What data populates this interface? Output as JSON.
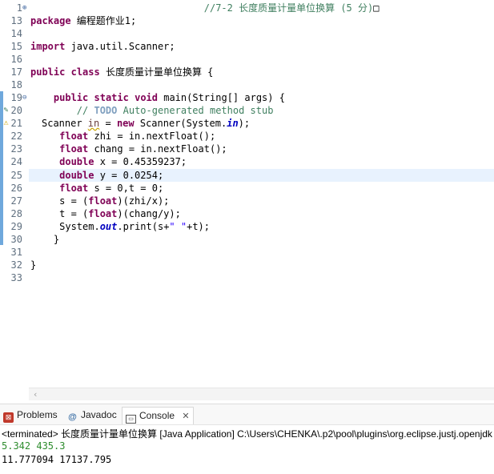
{
  "editor": {
    "line_numbers": [
      "1",
      "13",
      "14",
      "15",
      "16",
      "17",
      "18",
      "19",
      "20",
      "21",
      "22",
      "23",
      "24",
      "25",
      "26",
      "27",
      "28",
      "29",
      "30",
      "31",
      "32",
      "33"
    ],
    "fold_marks": {
      "line_1": "⊕",
      "line_19": "⊖"
    },
    "lines": {
      "l1_comment": "//7-2 长度质量计量单位换算 (5 分)",
      "l1_box": "□",
      "l13_kw": "package",
      "l13_rest": " 编程题作业1;",
      "l15_kw": "import",
      "l15_rest": " java.util.Scanner;",
      "l17_kw1": "public",
      "l17_kw2": "class",
      "l17_rest": " 长度质量计量单位换算 {",
      "l19_kw1": "public",
      "l19_kw2": "static",
      "l19_kw3": "void",
      "l19_rest": " main(String[] args) {",
      "l20_a": "// ",
      "l20_todo": "TODO",
      "l20_b": " Auto-generated method stub",
      "l21_a": "Scanner ",
      "l21_in": "in",
      "l21_b": " = ",
      "l21_new": "new",
      "l21_c": " Scanner(System.",
      "l21_in2": "in",
      "l21_d": ");",
      "l22_kw": "float",
      "l22_rest": " zhi = in.nextFloat();",
      "l23_kw": "float",
      "l23_rest": " chang = in.nextFloat();",
      "l24_kw": "double",
      "l24_rest": " x = 0.45359237;",
      "l25_kw": "double",
      "l25_rest": " y = 0.0254;",
      "l26_kw": "float",
      "l26_rest": " s = 0,t = 0;",
      "l27_a": "s = (",
      "l27_kw": "float",
      "l27_b": ")(zhi/x);",
      "l28_a": "t = (",
      "l28_kw": "float",
      "l28_b": ")(chang/y);",
      "l29_a": "System.",
      "l29_out": "out",
      "l29_b": ".print(s+",
      "l29_str": "\" \"",
      "l29_c": "+t);",
      "l30": "}",
      "l32": "}"
    },
    "scroll_arrow": "‹"
  },
  "console": {
    "tabs": {
      "problems": "Problems",
      "javadoc": "Javadoc",
      "console": "Console",
      "close": "✕"
    },
    "icons": {
      "problems": "problems-icon",
      "javadoc": "at-icon",
      "console": "console-icon"
    },
    "terminated_line": "<terminated> 长度质量计量单位换算 [Java Application] C:\\Users\\CHENKA\\.p2\\pool\\plugins\\org.eclipse.justj.openjdk",
    "output": [
      "5.342 435.3",
      "11.777094 17137.795"
    ]
  },
  "colors": {
    "keyword": "#7f0055",
    "comment": "#3f7f5f",
    "input_echo": "#2d8c2d",
    "cursor_line": "#e8f2fe"
  }
}
